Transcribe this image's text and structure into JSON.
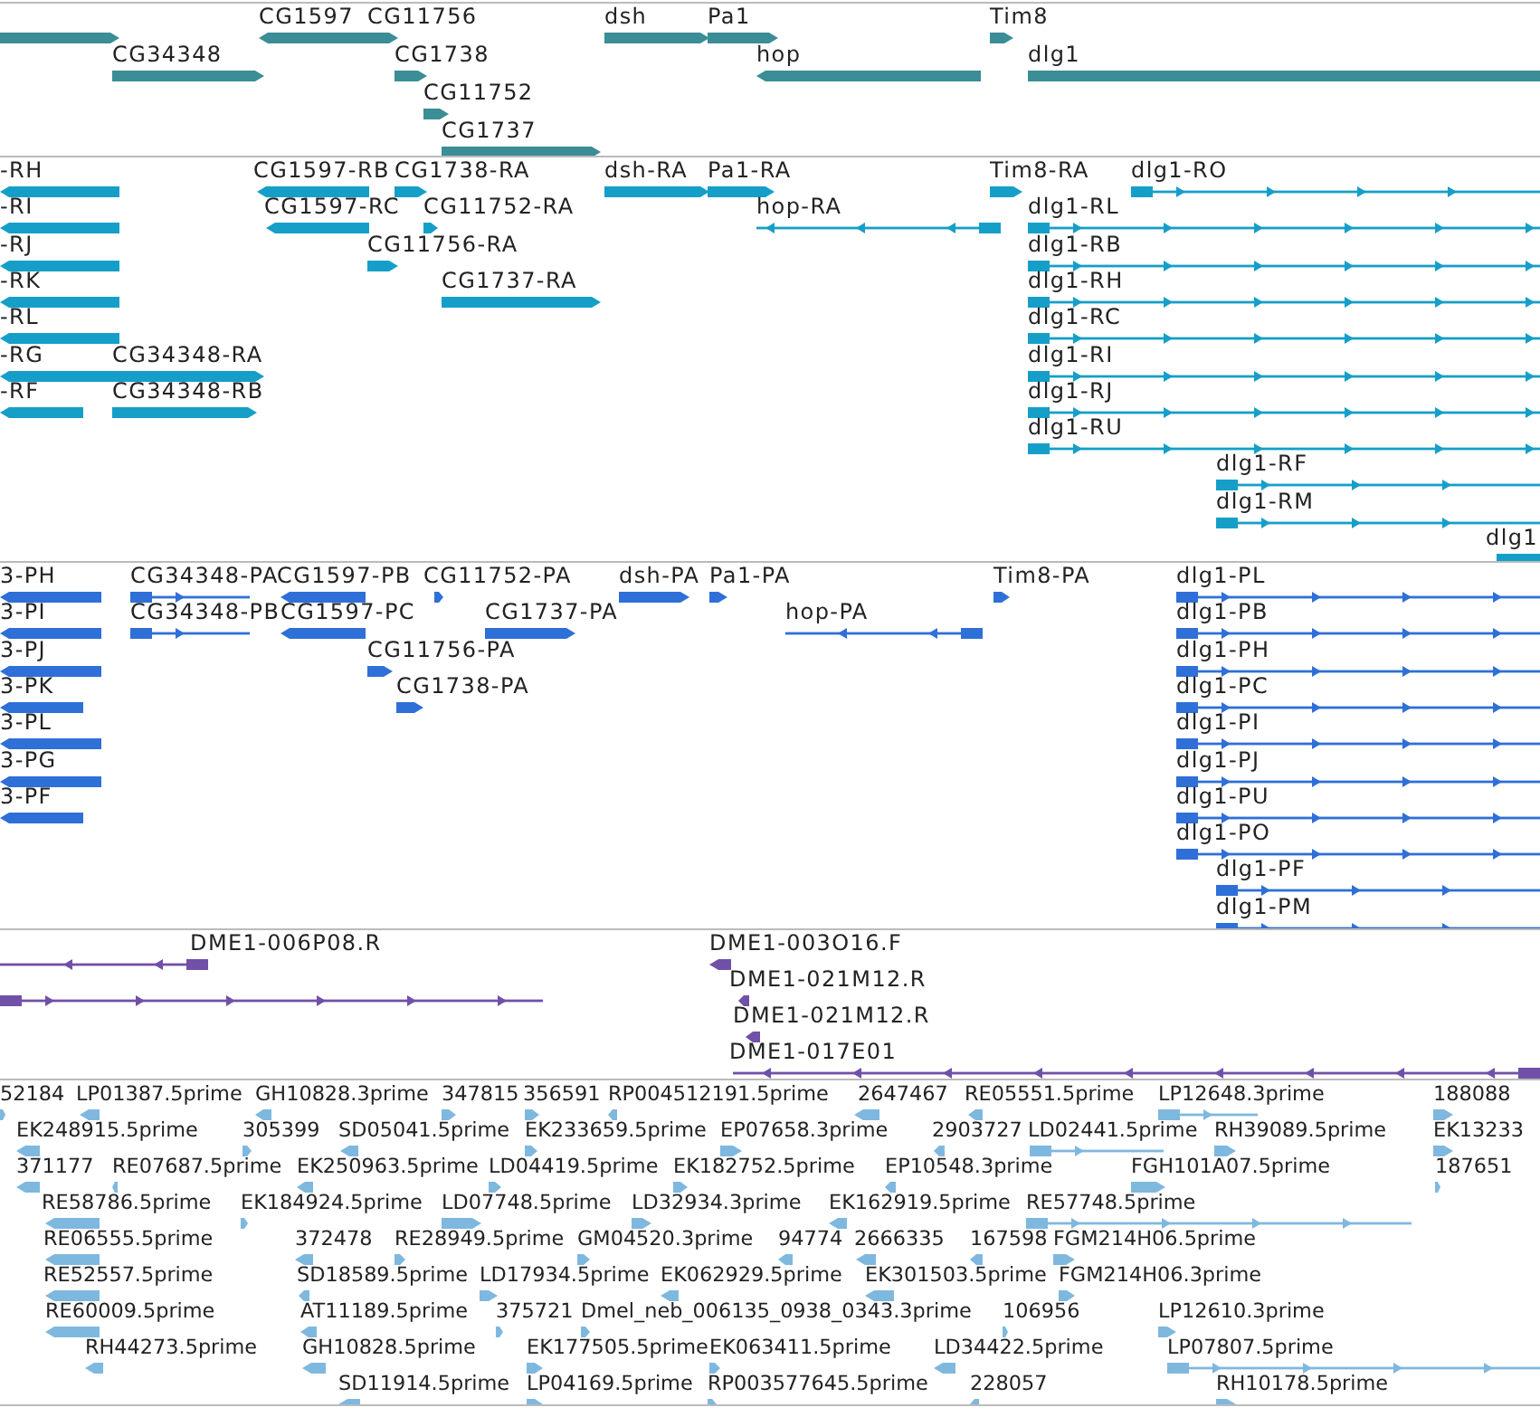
{
  "tracks": [
    {
      "kind": "gene",
      "lanes": [
        {
          "features": [
            {
              "kind": "forward"
            },
            {
              "label": "CG1597",
              "kind": "reverse"
            },
            {
              "label": "CG11756",
              "kind": "forward"
            },
            {
              "label": "dsh",
              "kind": "forward"
            },
            {
              "label": "Pa1",
              "kind": "forward"
            },
            {
              "label": "Tim8",
              "kind": "forward"
            }
          ]
        },
        {
          "features": [
            {
              "label": "CG34348",
              "kind": "forward"
            },
            {
              "label": "CG1738",
              "kind": "forward"
            },
            {
              "label": "hop",
              "kind": "reverse"
            },
            {
              "label": "dlg1",
              "kind": "forward"
            }
          ]
        },
        {
          "features": [
            {
              "label": "CG11752",
              "kind": "forward"
            }
          ]
        },
        {
          "features": [
            {
              "label": "CG1737",
              "kind": "forward"
            }
          ]
        }
      ]
    },
    {
      "kind": "transcript",
      "lanes": [
        {
          "features": [
            {
              "label": "-RH",
              "kind": "reverse"
            },
            {
              "label": "CG1597-RB",
              "kind": "reverse"
            },
            {
              "label": "CG1738-RA",
              "kind": "forward"
            },
            {
              "label": "dsh-RA",
              "kind": "forward"
            },
            {
              "label": "Pa1-RA",
              "kind": "forward"
            },
            {
              "label": "Tim8-RA",
              "kind": "forward"
            },
            {
              "label": "dlg1-RO",
              "kind": "forward"
            }
          ]
        },
        {
          "features": [
            {
              "label": "-RI",
              "kind": "reverse"
            },
            {
              "label": "CG1597-RC",
              "kind": "reverse"
            },
            {
              "label": "CG11752-RA",
              "kind": "forward"
            },
            {
              "label": "hop-RA",
              "kind": "reverse"
            },
            {
              "label": "dlg1-RL",
              "kind": "forward"
            }
          ]
        },
        {
          "features": [
            {
              "label": "-RJ",
              "kind": "reverse"
            },
            {
              "label": "CG11756-RA",
              "kind": "forward"
            },
            {
              "label": "dlg1-RB",
              "kind": "forward"
            }
          ]
        },
        {
          "features": [
            {
              "label": "-RK",
              "kind": "reverse"
            },
            {
              "label": "CG1737-RA",
              "kind": "forward"
            },
            {
              "label": "dlg1-RH",
              "kind": "forward"
            }
          ]
        },
        {
          "features": [
            {
              "label": "-RL",
              "kind": "reverse"
            },
            {
              "label": "dlg1-RC",
              "kind": "forward"
            }
          ]
        },
        {
          "features": [
            {
              "label": "-RG",
              "kind": "reverse"
            },
            {
              "label": "CG34348-RA",
              "kind": "forward"
            },
            {
              "label": "dlg1-RI",
              "kind": "forward"
            }
          ]
        },
        {
          "features": [
            {
              "label": "-RF",
              "kind": "reverse"
            },
            {
              "label": "CG34348-RB",
              "kind": "forward"
            },
            {
              "label": "dlg1-RJ",
              "kind": "forward"
            }
          ]
        },
        {
          "features": [
            {
              "label": "dlg1-RU",
              "kind": "forward"
            }
          ]
        },
        {
          "features": [
            {
              "label": "dlg1-RF",
              "kind": "forward"
            }
          ]
        },
        {
          "features": [
            {
              "label": "dlg1-RM",
              "kind": "forward"
            }
          ]
        },
        {
          "features": [
            {
              "label": "dlg1",
              "kind": "forward"
            }
          ]
        }
      ]
    },
    {
      "kind": "protein",
      "lanes": [
        {
          "features": [
            {
              "label": "3-PH",
              "kind": "reverse"
            },
            {
              "label": "CG34348-PA",
              "kind": "forward"
            },
            {
              "label": "CG1597-PB",
              "kind": "reverse"
            },
            {
              "label": "CG11752-PA",
              "kind": "forward"
            },
            {
              "label": "dsh-PA",
              "kind": "forward"
            },
            {
              "label": "Pa1-PA",
              "kind": "forward"
            },
            {
              "label": "Tim8-PA",
              "kind": "forward"
            },
            {
              "label": "dlg1-PL",
              "kind": "forward"
            }
          ]
        },
        {
          "features": [
            {
              "label": "3-PI",
              "kind": "reverse"
            },
            {
              "label": "CG34348-PB",
              "kind": "forward"
            },
            {
              "label": "CG1597-PC",
              "kind": "reverse"
            },
            {
              "label": "CG1737-PA",
              "kind": "forward"
            },
            {
              "label": "hop-PA",
              "kind": "reverse"
            },
            {
              "label": "dlg1-PB",
              "kind": "forward"
            }
          ]
        },
        {
          "features": [
            {
              "label": "3-PJ",
              "kind": "reverse"
            },
            {
              "label": "CG11756-PA",
              "kind": "forward"
            },
            {
              "label": "dlg1-PH",
              "kind": "forward"
            }
          ]
        },
        {
          "features": [
            {
              "label": "3-PK",
              "kind": "reverse"
            },
            {
              "label": "CG1738-PA",
              "kind": "forward"
            },
            {
              "label": "dlg1-PC",
              "kind": "forward"
            }
          ]
        },
        {
          "features": [
            {
              "label": "3-PL",
              "kind": "reverse"
            },
            {
              "label": "dlg1-PI",
              "kind": "forward"
            }
          ]
        },
        {
          "features": [
            {
              "label": "3-PG",
              "kind": "reverse"
            },
            {
              "label": "dlg1-PJ",
              "kind": "forward"
            }
          ]
        },
        {
          "features": [
            {
              "label": "3-PF",
              "kind": "reverse"
            },
            {
              "label": "dlg1-PU",
              "kind": "forward"
            }
          ]
        },
        {
          "features": [
            {
              "label": "dlg1-PO",
              "kind": "forward"
            }
          ]
        },
        {
          "features": [
            {
              "label": "dlg1-PF",
              "kind": "forward"
            }
          ]
        },
        {
          "features": [
            {
              "label": "dlg1-PM",
              "kind": "forward"
            }
          ]
        }
      ]
    },
    {
      "kind": "clone",
      "lanes": [
        {
          "features": [
            {
              "label": "DME1-006P08.R",
              "kind": "reverse"
            },
            {
              "label": "DME1-003O16.F",
              "kind": "reverse"
            }
          ]
        },
        {
          "features": [
            {
              "kind": "forward"
            },
            {
              "label": "DME1-021M12.R",
              "kind": "reverse"
            }
          ]
        },
        {
          "features": [
            {
              "label": "DME1-021M12.R",
              "kind": "reverse"
            }
          ]
        },
        {
          "features": [
            {
              "label": "DME1-017E01",
              "kind": "reverse"
            }
          ]
        }
      ]
    },
    {
      "kind": "est",
      "lanes": [
        {
          "features": [
            {
              "label": "52184",
              "kind": "forward"
            },
            {
              "label": "LP01387.5prime",
              "kind": "reverse"
            },
            {
              "label": "GH10828.3prime",
              "kind": "reverse"
            },
            {
              "label": "347815",
              "kind": "forward"
            },
            {
              "label": "356591",
              "kind": "forward"
            },
            {
              "label": "RP004512191.5prime",
              "kind": "reverse"
            },
            {
              "label": "2647467",
              "kind": "reverse"
            },
            {
              "label": "RE05551.5prime",
              "kind": "reverse"
            },
            {
              "label": "LP12648.3prime",
              "kind": "forward"
            },
            {
              "label": "188088",
              "kind": "forward"
            }
          ]
        },
        {
          "features": [
            {
              "label": "EK248915.5prime",
              "kind": "reverse"
            },
            {
              "label": "305399",
              "kind": "forward"
            },
            {
              "label": "SD05041.5prime",
              "kind": "reverse"
            },
            {
              "label": "EK233659.5prime",
              "kind": "forward"
            },
            {
              "label": "EP07658.3prime",
              "kind": "forward"
            },
            {
              "label": "2903727",
              "kind": "reverse"
            },
            {
              "label": "LD02441.5prime",
              "kind": "forward"
            },
            {
              "label": "RH39089.5prime",
              "kind": "forward"
            },
            {
              "label": "EK13233",
              "kind": "forward"
            }
          ]
        },
        {
          "features": [
            {
              "label": "371177",
              "kind": "reverse"
            },
            {
              "label": "RE07687.5prime",
              "kind": "reverse"
            },
            {
              "label": "EK250963.5prime",
              "kind": "reverse"
            },
            {
              "label": "LD04419.5prime",
              "kind": "forward"
            },
            {
              "label": "EK182752.5prime",
              "kind": "forward"
            },
            {
              "label": "EP10548.3prime",
              "kind": "reverse"
            },
            {
              "label": "FGH101A07.5prime",
              "kind": "forward"
            },
            {
              "label": "187651",
              "kind": "forward"
            }
          ]
        },
        {
          "features": [
            {
              "label": "RE58786.5prime",
              "kind": "reverse"
            },
            {
              "label": "EK184924.5prime",
              "kind": "forward"
            },
            {
              "label": "LD07748.5prime",
              "kind": "forward"
            },
            {
              "label": "LD32934.3prime",
              "kind": "forward"
            },
            {
              "label": "EK162919.5prime",
              "kind": "reverse"
            },
            {
              "label": "RE57748.5prime",
              "kind": "forward"
            }
          ]
        },
        {
          "features": [
            {
              "label": "RE06555.5prime",
              "kind": "reverse"
            },
            {
              "label": "372478",
              "kind": "reverse"
            },
            {
              "label": "RE28949.5prime",
              "kind": "forward"
            },
            {
              "label": "GM04520.3prime",
              "kind": "forward"
            },
            {
              "label": "94774",
              "kind": "reverse"
            },
            {
              "label": "2666335",
              "kind": "reverse"
            },
            {
              "label": "167598",
              "kind": "reverse"
            },
            {
              "label": "FGM214H06.5prime",
              "kind": "forward"
            }
          ]
        },
        {
          "features": [
            {
              "label": "RE52557.5prime",
              "kind": "reverse"
            },
            {
              "label": "SD18589.5prime",
              "kind": "reverse"
            },
            {
              "label": "LD17934.5prime",
              "kind": "forward"
            },
            {
              "label": "EK062929.5prime",
              "kind": "reverse"
            },
            {
              "label": "EK301503.5prime",
              "kind": "reverse"
            },
            {
              "label": "FGM214H06.3prime",
              "kind": "forward"
            }
          ]
        },
        {
          "features": [
            {
              "label": "RE60009.5prime",
              "kind": "reverse"
            },
            {
              "label": "AT11189.5prime",
              "kind": "reverse"
            },
            {
              "label": "375721",
              "kind": "forward"
            },
            {
              "label": "Dmel_neb_006135_0938_0343.3prime",
              "kind": "forward"
            },
            {
              "label": "106956",
              "kind": "forward"
            },
            {
              "label": "LP12610.3prime",
              "kind": "forward"
            }
          ]
        },
        {
          "features": [
            {
              "label": "RH44273.5prime",
              "kind": "reverse"
            },
            {
              "label": "GH10828.5prime",
              "kind": "reverse"
            },
            {
              "label": "EK177505.5prime",
              "kind": "forward"
            },
            {
              "label": "EK063411.5prime",
              "kind": "forward"
            },
            {
              "label": "LD34422.5prime",
              "kind": "reverse"
            },
            {
              "label": "LP07807.5prime",
              "kind": "forward"
            }
          ]
        },
        {
          "features": [
            {
              "label": "SD11914.5prime",
              "kind": "reverse"
            },
            {
              "label": "LP04169.5prime",
              "kind": "forward"
            },
            {
              "label": "RP003577645.5prime",
              "kind": "forward"
            },
            {
              "label": "228057",
              "kind": "reverse"
            },
            {
              "label": "RH10178.5prime",
              "kind": "forward"
            }
          ]
        }
      ]
    }
  ]
}
